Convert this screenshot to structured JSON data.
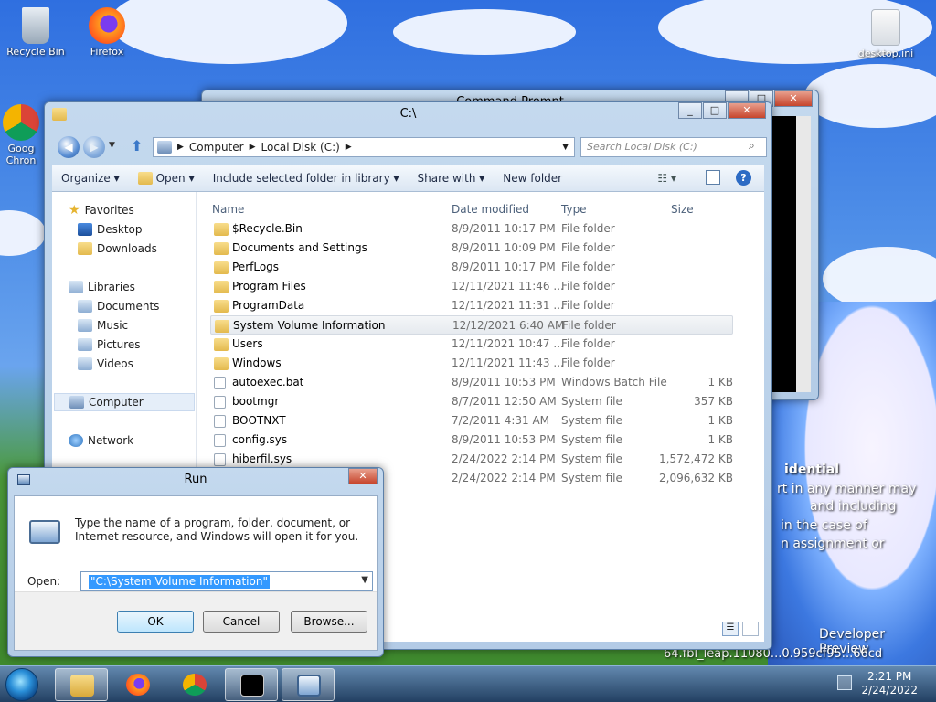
{
  "desktop": {
    "icons": [
      {
        "label": "Recycle Bin"
      },
      {
        "label": "Firefox"
      },
      {
        "label": "Goog Chron"
      },
      {
        "label": "desktop.ini"
      }
    ],
    "wallpaper_text": [
      "idential",
      "rt in any manner may",
      "and including",
      "in the case of",
      "n assignment or",
      "Developer Preview",
      "64.fbl_leap.11080...0.959cf95...66cd"
    ]
  },
  "cmd": {
    "title": "Command Prompt"
  },
  "explorer": {
    "title": "C:\\",
    "breadcrumb": [
      "Computer",
      "Local Disk (C:)"
    ],
    "search_placeholder": "Search Local Disk (C:)",
    "toolbar": {
      "organize": "Organize",
      "open": "Open",
      "include": "Include selected folder in library",
      "share": "Share with",
      "new_folder": "New folder"
    },
    "nav": {
      "favorites": "Favorites",
      "desktop": "Desktop",
      "downloads": "Downloads",
      "libraries": "Libraries",
      "documents": "Documents",
      "music": "Music",
      "pictures": "Pictures",
      "videos": "Videos",
      "computer": "Computer",
      "network": "Network"
    },
    "columns": {
      "name": "Name",
      "date": "Date modified",
      "type": "Type",
      "size": "Size"
    },
    "files": [
      {
        "name": "$Recycle.Bin",
        "date": "8/9/2011 10:17 PM",
        "type": "File folder",
        "size": "",
        "kind": "folder"
      },
      {
        "name": "Documents and Settings",
        "date": "8/9/2011 10:09 PM",
        "type": "File folder",
        "size": "",
        "kind": "link"
      },
      {
        "name": "PerfLogs",
        "date": "8/9/2011 10:17 PM",
        "type": "File folder",
        "size": "",
        "kind": "folder"
      },
      {
        "name": "Program Files",
        "date": "12/11/2021 11:46 ...",
        "type": "File folder",
        "size": "",
        "kind": "folder"
      },
      {
        "name": "ProgramData",
        "date": "12/11/2021 11:31 ...",
        "type": "File folder",
        "size": "",
        "kind": "folder"
      },
      {
        "name": "System Volume Information",
        "date": "12/12/2021 6:40 AM",
        "type": "File folder",
        "size": "",
        "kind": "folder"
      },
      {
        "name": "Users",
        "date": "12/11/2021 10:47 ...",
        "type": "File folder",
        "size": "",
        "kind": "folder"
      },
      {
        "name": "Windows",
        "date": "12/11/2021 11:43 ...",
        "type": "File folder",
        "size": "",
        "kind": "folder"
      },
      {
        "name": "autoexec.bat",
        "date": "8/9/2011 10:53 PM",
        "type": "Windows Batch File",
        "size": "1 KB",
        "kind": "file"
      },
      {
        "name": "bootmgr",
        "date": "8/7/2011 12:50 AM",
        "type": "System file",
        "size": "357 KB",
        "kind": "file"
      },
      {
        "name": "BOOTNXT",
        "date": "7/2/2011 4:31 AM",
        "type": "System file",
        "size": "1 KB",
        "kind": "file"
      },
      {
        "name": "config.sys",
        "date": "8/9/2011 10:53 PM",
        "type": "System file",
        "size": "1 KB",
        "kind": "file"
      },
      {
        "name": "hiberfil.sys",
        "date": "2/24/2022 2:14 PM",
        "type": "System file",
        "size": "1,572,472 KB",
        "kind": "file"
      },
      {
        "name": "pagefile.sys",
        "date": "2/24/2022 2:14 PM",
        "type": "System file",
        "size": "2,096,632 KB",
        "kind": "file"
      }
    ]
  },
  "run": {
    "title": "Run",
    "description": "Type the name of a program, folder, document, or Internet resource, and Windows will open it for you.",
    "open_label": "Open:",
    "input_value": "\"C:\\System Volume Information\"",
    "ok": "OK",
    "cancel": "Cancel",
    "browse": "Browse..."
  },
  "taskbar": {
    "time": "2:21 PM",
    "date": "2/24/2022"
  }
}
